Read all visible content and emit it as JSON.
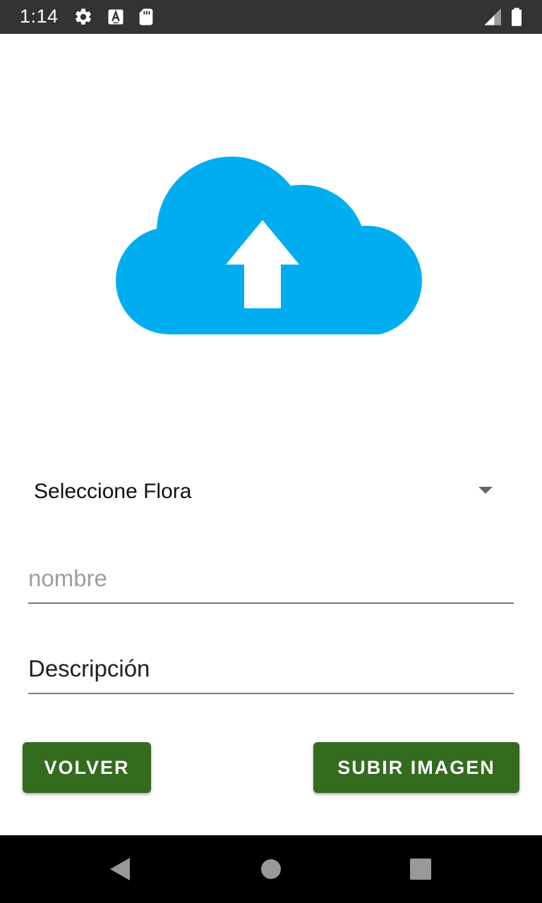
{
  "status_bar": {
    "time": "1:14",
    "icons": [
      "gear-icon",
      "font-a-icon",
      "sd-card-icon",
      "signal-icon",
      "battery-icon"
    ]
  },
  "main": {
    "upload_icon": "cloud-upload-icon",
    "spinner": {
      "selected": "Seleccione Flora"
    },
    "nombre_field": {
      "value": "",
      "placeholder": "nombre"
    },
    "descripcion_field": {
      "value": "Descripción",
      "placeholder": ""
    },
    "buttons": {
      "back_label": "VOLVER",
      "upload_label": "SUBIR IMAGEN"
    }
  },
  "nav_bar": {
    "icons": [
      "back-icon",
      "home-icon",
      "recents-icon"
    ]
  },
  "colors": {
    "status_bar": "#333333",
    "cloud": "#00aeef",
    "button": "#336b1f",
    "nav_bar": "#000000"
  }
}
